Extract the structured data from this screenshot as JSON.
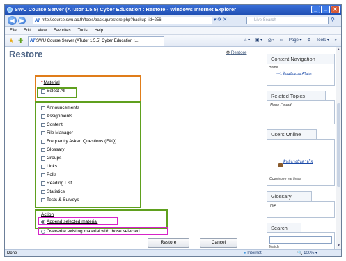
{
  "window": {
    "title": "SWU Course Server (ATutor 1.5.5) Cyber Education : Restore - Windows Internet Explorer",
    "controls": [
      "_",
      "□",
      "✕"
    ]
  },
  "address": {
    "url": "http://course.swu.ac.th/tools/backup/restore.php?backup_id=256",
    "search_placeholder": "Live Search"
  },
  "menu": [
    "File",
    "Edit",
    "View",
    "Favorites",
    "Tools",
    "Help"
  ],
  "tab": {
    "title": "SWU Course Server (ATutor 1.5.5) Cyber Education :..."
  },
  "commands": {
    "page": "Page",
    "tools": "Tools"
  },
  "page": {
    "title": "Restore",
    "restore_link": "Restore",
    "material_label": "Material",
    "select_all": "Select All",
    "materials": [
      "Announcements",
      "Assignments",
      "Content",
      "File Manager",
      "Frequently Asked Questions (FAQ)",
      "Glossary",
      "Groups",
      "Links",
      "Polls",
      "Reading List",
      "Statistics",
      "Tests & Surveys"
    ],
    "action_label": "Action",
    "action_append": "Append selected material",
    "action_overwrite": "Overwrite existing material with those selected",
    "restore_button": "Restore",
    "cancel_button": "Cancel"
  },
  "sidebar": {
    "content_navigation": "Content Navigation",
    "nav_home": "Home",
    "nav_child": "1 ต้นฉบับแบบ ATutor",
    "related_topics": "Related Topics",
    "none_found": "None Found",
    "users_online": "Users Online",
    "online_user": "ศิษย์แรงบันดาลใจ",
    "guests_not_listed": "Guests are not listed",
    "glossary": "Glossary",
    "glossary_value": "N/A",
    "search": "Search",
    "search_hint": "Match"
  },
  "status": {
    "text": "Done",
    "zone": "Internet",
    "zoom": "100%"
  }
}
